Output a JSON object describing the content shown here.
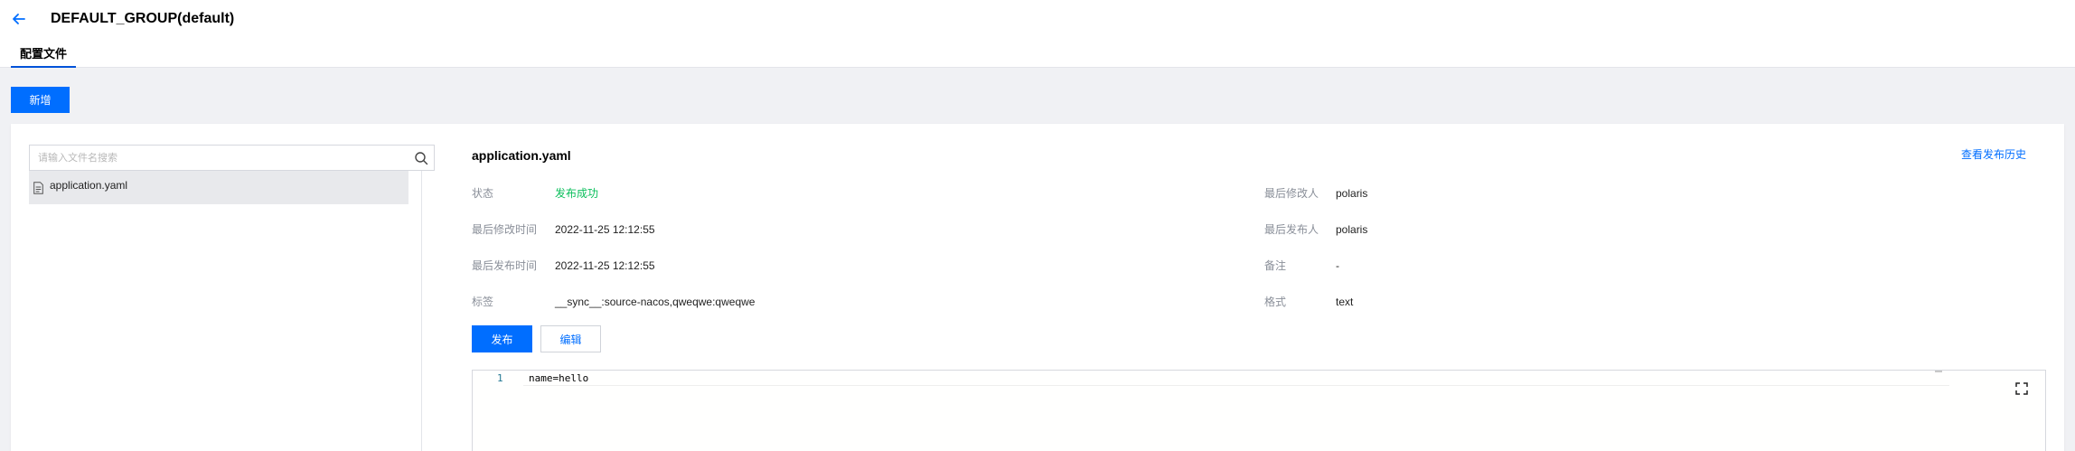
{
  "header": {
    "title": "DEFAULT_GROUP(default)",
    "back_icon": "arrow-left-icon",
    "tabs": [
      {
        "label": "配置文件",
        "active": true
      }
    ]
  },
  "toolbar": {
    "add_label": "新增"
  },
  "file_list": {
    "search_placeholder": "请输入文件名搜索",
    "search_icon": "search-icon",
    "items": [
      {
        "name": "application.yaml",
        "icon": "file-icon",
        "selected": true
      }
    ]
  },
  "detail": {
    "title": "application.yaml",
    "history_link": "查看发布历史",
    "fields": {
      "status": {
        "label": "状态",
        "value": "发布成功"
      },
      "modified_time": {
        "label": "最后修改时间",
        "value": "2022-11-25 12:12:55"
      },
      "published_time": {
        "label": "最后发布时间",
        "value": "2022-11-25 12:12:55"
      },
      "tags": {
        "label": "标签",
        "value": "__sync__:source-nacos,qweqwe:qweqwe"
      },
      "modified_by": {
        "label": "最后修改人",
        "value": "polaris"
      },
      "published_by": {
        "label": "最后发布人",
        "value": "polaris"
      },
      "remark": {
        "label": "备注",
        "value": "-"
      },
      "format": {
        "label": "格式",
        "value": "text"
      }
    },
    "publish_label": "发布",
    "edit_label": "编辑"
  },
  "editor": {
    "lines": [
      {
        "number": "1",
        "text": "name=hello"
      }
    ],
    "fullscreen_icon": "fullscreen-icon"
  },
  "colors": {
    "primary": "#006eff",
    "success": "#0abf5b",
    "tab_underline": "#0052d9",
    "background": "#f0f1f4"
  }
}
